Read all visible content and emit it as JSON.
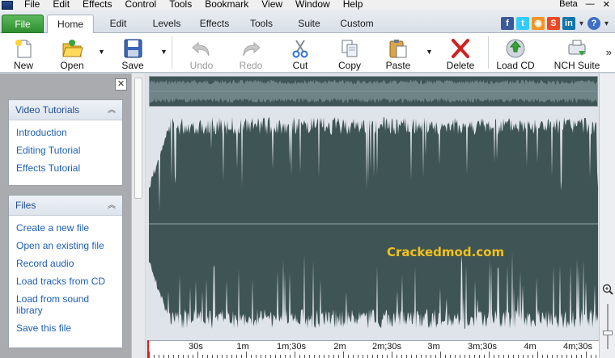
{
  "menubar": {
    "items": [
      "File",
      "Edit",
      "Effects",
      "Control",
      "Tools",
      "Bookmark",
      "View",
      "Window",
      "Help"
    ],
    "beta_label": "Beta"
  },
  "tabs": [
    "File",
    "Home",
    "Edit",
    "Levels",
    "Effects",
    "Tools",
    "Suite",
    "Custom"
  ],
  "active_tab": "Home",
  "social": {
    "icons": [
      "facebook-icon",
      "twitter-icon",
      "rss-icon",
      "stumbleupon-icon",
      "linkedin-icon",
      "help-icon"
    ],
    "facebook": "f",
    "twitter": "t",
    "rss": "◉",
    "stumbleupon": "S",
    "linkedin": "in",
    "help": "?",
    "colors": {
      "facebook": "#3b5998",
      "twitter": "#33ccff",
      "rss": "#f7931e",
      "stumbleupon": "#eb4924",
      "linkedin": "#0e76a8"
    }
  },
  "toolbar": {
    "new": "New",
    "open": "Open",
    "save": "Save",
    "undo": "Undo",
    "redo": "Redo",
    "cut": "Cut",
    "copy": "Copy",
    "paste": "Paste",
    "delete": "Delete",
    "load_cd": "Load CD",
    "nch_suite": "NCH Suite",
    "more": "»"
  },
  "sidebar": {
    "close": "✕",
    "video_tutorials": {
      "title": "Video Tutorials",
      "links": [
        "Introduction",
        "Editing Tutorial",
        "Effects Tutorial"
      ]
    },
    "files": {
      "title": "Files",
      "links": [
        "Create a new file",
        "Open an existing file",
        "Record audio",
        "Load tracks from CD",
        "Load from sound library",
        "Save this file"
      ]
    }
  },
  "waveform": {
    "watermark": "Crackedmod.com",
    "colors": {
      "wave": "#3f5455",
      "background": "#dfe4ea",
      "playhead": "#e21919"
    }
  },
  "timeline": {
    "labels": [
      "30s",
      "1m",
      "1m;30s",
      "2m",
      "2m;30s",
      "3m",
      "3m;30s",
      "4m",
      "4m;30s"
    ]
  }
}
